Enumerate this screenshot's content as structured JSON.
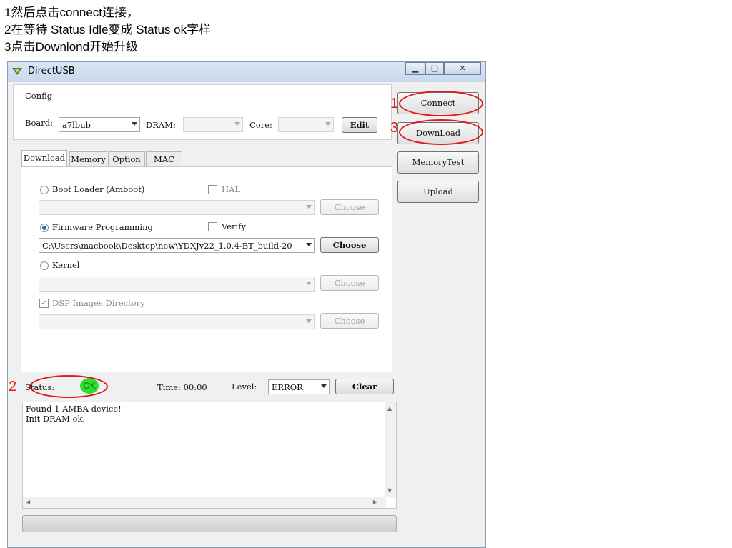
{
  "instructions": [
    "1然后点击connect连接，",
    "2在等待 Status  Idle变成 Status  ok字样",
    "3点击Downlond开始升级"
  ],
  "window": {
    "title": "DirectUSB"
  },
  "config": {
    "group_label": "Config",
    "board_label": "Board:",
    "board_value": "a7lbub",
    "dram_label": "DRAM:",
    "core_label": "Core:",
    "edit_label": "Edit"
  },
  "side_buttons": {
    "connect": "Connect",
    "download": "DownLoad",
    "memorytest": "MemoryTest",
    "upload": "Upload"
  },
  "tabs": [
    "Download",
    "Memory",
    "Option",
    "MAC"
  ],
  "download_tab": {
    "boot_loader": "Boot Loader (Amboot)",
    "hal": "HAL",
    "firmware": "Firmware Programming",
    "verify": "Verify",
    "firmware_path": "C:\\Users\\macbook\\Desktop\\new\\YDXJv22_1.0.4-BT_build-20",
    "kernel": "Kernel",
    "dsp": "DSP Images Directory",
    "choose": "Choose"
  },
  "status": {
    "label": "Status:",
    "value": "OK",
    "time": "Time: 00:00",
    "level_label": "Level:",
    "level_value": "ERROR",
    "clear": "Clear"
  },
  "log": [
    "Found 1 AMBA device!",
    "Init DRAM ok."
  ],
  "annotations": [
    "1",
    "3",
    "2"
  ],
  "colors": {
    "annotation_red": "#e01818",
    "ok_green": "#2ee02e",
    "radio_blue": "#2a6cc8"
  }
}
